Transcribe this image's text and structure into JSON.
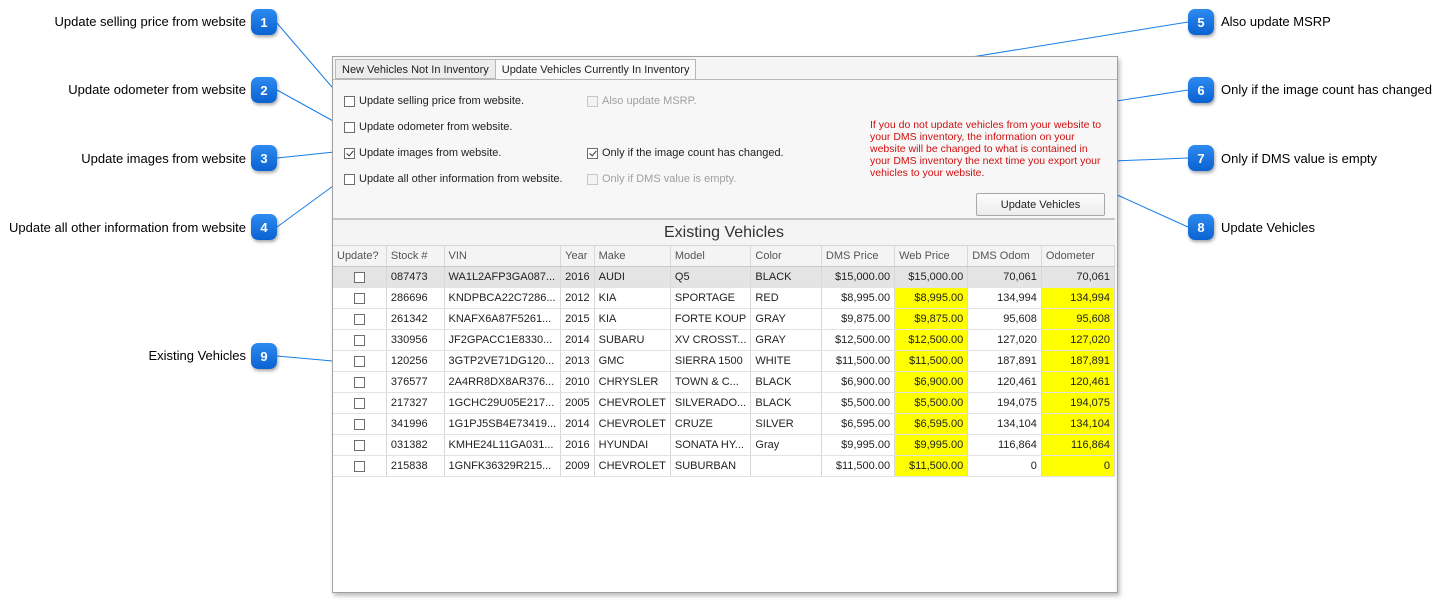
{
  "callouts": [
    {
      "num": "1",
      "label": "Update selling price from website"
    },
    {
      "num": "2",
      "label": "Update odometer from website"
    },
    {
      "num": "3",
      "label": "Update images from website"
    },
    {
      "num": "4",
      "label": "Update all other information from website"
    },
    {
      "num": "5",
      "label": "Also update MSRP"
    },
    {
      "num": "6",
      "label": "Only if the image count has changed"
    },
    {
      "num": "7",
      "label": "Only if DMS value is empty"
    },
    {
      "num": "8",
      "label": "Update Vehicles"
    },
    {
      "num": "9",
      "label": "Existing Vehicles"
    }
  ],
  "tabs": [
    {
      "label": "New Vehicles Not In Inventory",
      "active": false
    },
    {
      "label": "Update Vehicles Currently In Inventory",
      "active": true
    }
  ],
  "options": {
    "selling_price": {
      "label": "Update selling price from website.",
      "checked": false
    },
    "odometer": {
      "label": "Update odometer from website.",
      "checked": false
    },
    "images": {
      "label": "Update images from website.",
      "checked": true
    },
    "all_other": {
      "label": "Update all other information from website.",
      "checked": false
    },
    "msrp": {
      "label": "Also update MSRP.",
      "checked": false,
      "disabled": true
    },
    "image_count": {
      "label": "Only if the image count has changed.",
      "checked": true
    },
    "dms_empty": {
      "label": "Only if DMS value is empty.",
      "checked": false,
      "disabled": true
    }
  },
  "note": "If you do not update vehicles from your website to your DMS inventory, the information on your website will be changed to what is contained in your DMS inventory the next time you export your vehicles to your website.",
  "update_button": "Update Vehicles",
  "grid": {
    "title": "Existing Vehicles",
    "columns": [
      "Update?",
      "Stock #",
      "VIN",
      "Year",
      "Make",
      "Model",
      "Color",
      "DMS Price",
      "Web Price",
      "DMS Odom",
      "Odometer"
    ],
    "rows": [
      {
        "stock": "087473",
        "vin": "WA1L2AFP3GA087...",
        "year": "2016",
        "make": "AUDI",
        "model": "Q5",
        "color": "BLACK",
        "dms_price": "$15,000.00",
        "web_price": "$15,000.00",
        "dms_odom": "70,061",
        "odometer": "70,061",
        "price_diff": false,
        "odom_diff": false,
        "selected": true
      },
      {
        "stock": "286696",
        "vin": "KNDPBCA22C7286...",
        "year": "2012",
        "make": "KIA",
        "model": "SPORTAGE",
        "color": "RED",
        "dms_price": "$8,995.00",
        "web_price": "$8,995.00",
        "dms_odom": "134,994",
        "odometer": "134,994",
        "price_diff": true,
        "odom_diff": true,
        "selected": false
      },
      {
        "stock": "261342",
        "vin": "KNAFX6A87F5261...",
        "year": "2015",
        "make": "KIA",
        "model": "FORTE KOUP",
        "color": "GRAY",
        "dms_price": "$9,875.00",
        "web_price": "$9,875.00",
        "dms_odom": "95,608",
        "odometer": "95,608",
        "price_diff": true,
        "odom_diff": true,
        "selected": false
      },
      {
        "stock": "330956",
        "vin": "JF2GPACC1E8330...",
        "year": "2014",
        "make": "SUBARU",
        "model": "XV CROSST...",
        "color": "GRAY",
        "dms_price": "$12,500.00",
        "web_price": "$12,500.00",
        "dms_odom": "127,020",
        "odometer": "127,020",
        "price_diff": true,
        "odom_diff": true,
        "selected": false
      },
      {
        "stock": "120256",
        "vin": "3GTP2VE71DG120...",
        "year": "2013",
        "make": "GMC",
        "model": "SIERRA 1500",
        "color": "WHITE",
        "dms_price": "$11,500.00",
        "web_price": "$11,500.00",
        "dms_odom": "187,891",
        "odometer": "187,891",
        "price_diff": true,
        "odom_diff": true,
        "selected": false
      },
      {
        "stock": "376577",
        "vin": "2A4RR8DX8AR376...",
        "year": "2010",
        "make": "CHRYSLER",
        "model": "TOWN & C...",
        "color": "BLACK",
        "dms_price": "$6,900.00",
        "web_price": "$6,900.00",
        "dms_odom": "120,461",
        "odometer": "120,461",
        "price_diff": true,
        "odom_diff": true,
        "selected": false
      },
      {
        "stock": "217327",
        "vin": "1GCHC29U05E217...",
        "year": "2005",
        "make": "CHEVROLET",
        "model": "SILVERADO...",
        "color": "BLACK",
        "dms_price": "$5,500.00",
        "web_price": "$5,500.00",
        "dms_odom": "194,075",
        "odometer": "194,075",
        "price_diff": true,
        "odom_diff": true,
        "selected": false
      },
      {
        "stock": "341996",
        "vin": "1G1PJ5SB4E73419...",
        "year": "2014",
        "make": "CHEVROLET",
        "model": "CRUZE",
        "color": "SILVER",
        "dms_price": "$6,595.00",
        "web_price": "$6,595.00",
        "dms_odom": "134,104",
        "odometer": "134,104",
        "price_diff": true,
        "odom_diff": true,
        "selected": false
      },
      {
        "stock": "031382",
        "vin": "KMHE24L11GA031...",
        "year": "2016",
        "make": "HYUNDAI",
        "model": "SONATA HY...",
        "color": "Gray",
        "dms_price": "$9,995.00",
        "web_price": "$9,995.00",
        "dms_odom": "116,864",
        "odometer": "116,864",
        "price_diff": true,
        "odom_diff": true,
        "selected": false
      },
      {
        "stock": "215838",
        "vin": "1GNFK36329R215...",
        "year": "2009",
        "make": "CHEVROLET",
        "model": "SUBURBAN",
        "color": "",
        "dms_price": "$11,500.00",
        "web_price": "$11,500.00",
        "dms_odom": "0",
        "odometer": "0",
        "price_diff": true,
        "odom_diff": true,
        "selected": false
      }
    ]
  }
}
